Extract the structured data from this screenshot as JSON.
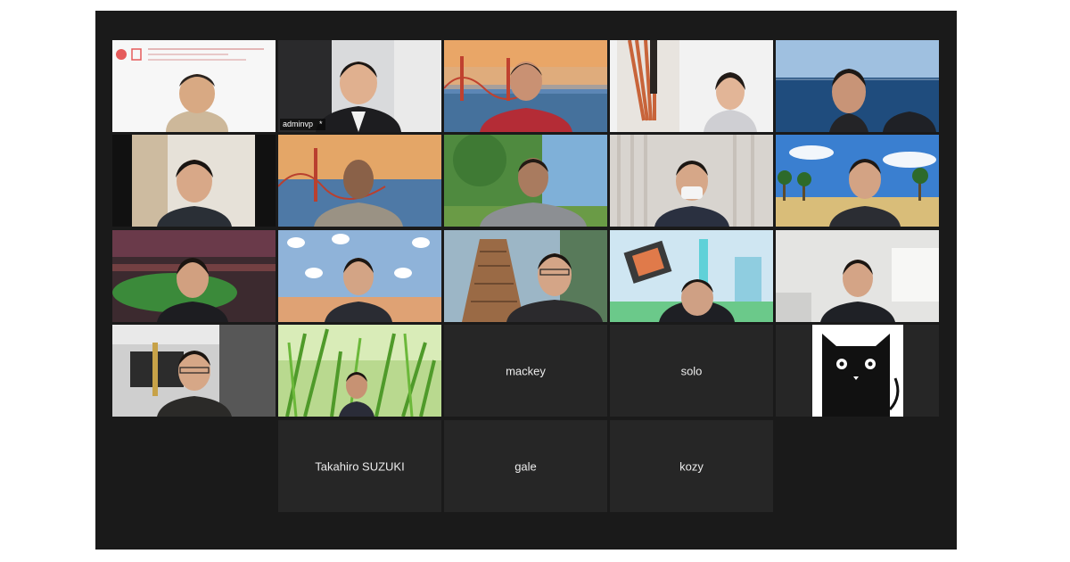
{
  "meeting": {
    "active_speaker_tag": "adminvp  *",
    "camera_off_names": [
      "mackey",
      "solo",
      "Takahiro SUZUKI",
      "gale",
      "kozy"
    ]
  },
  "colors": {
    "window_bg": "#1a1a1a",
    "tile_off_bg": "#262626",
    "active_border": "#d6e05a"
  },
  "icons": {
    "avatar_left": "cat-avatar-icon"
  }
}
